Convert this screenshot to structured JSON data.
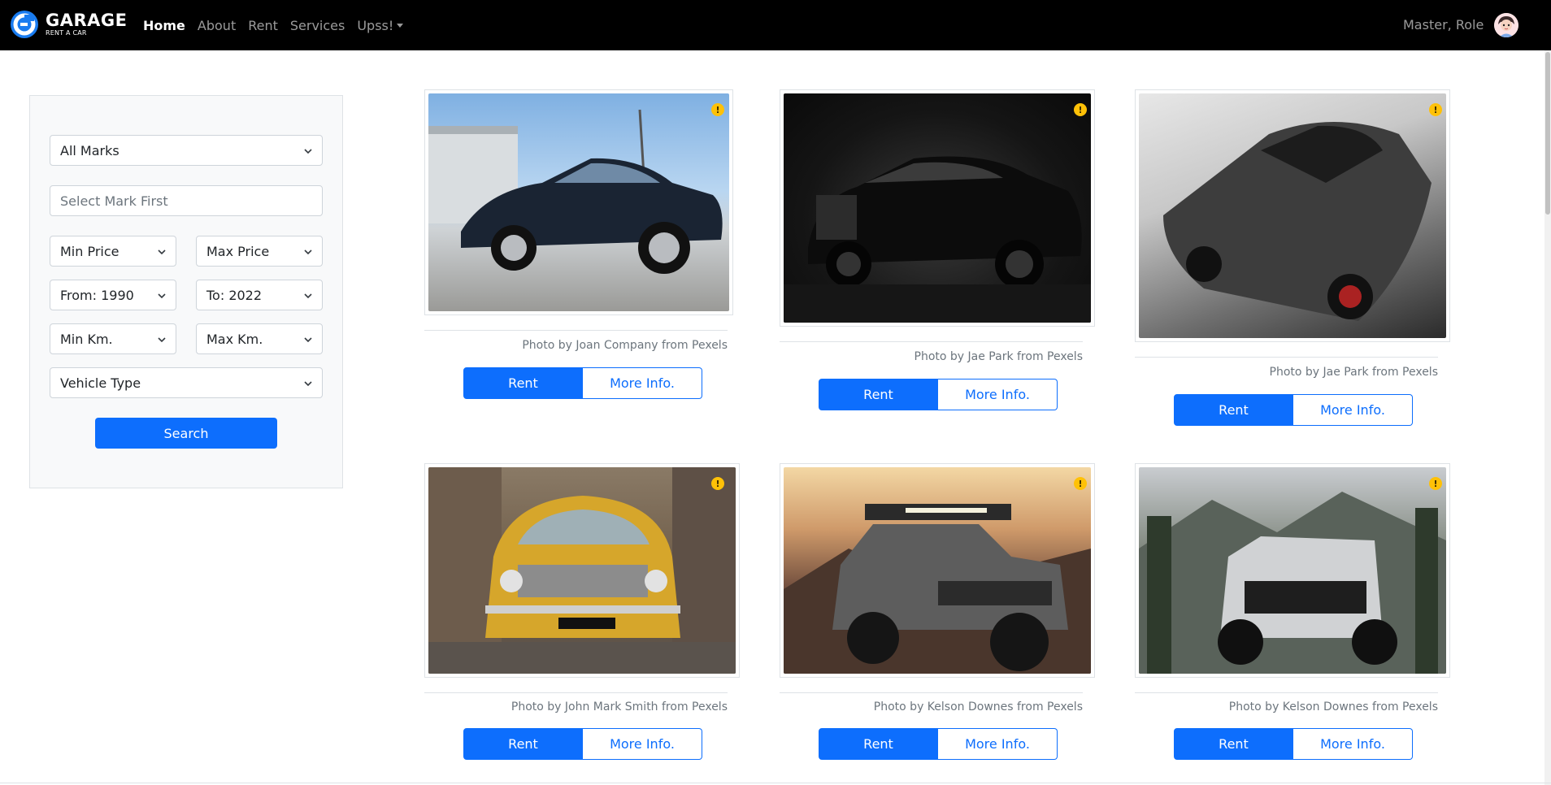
{
  "brand": {
    "name": "GARAGE",
    "subtitle": "RENT A CAR"
  },
  "nav": {
    "links": [
      "Home",
      "About",
      "Rent",
      "Services",
      "Upss!"
    ],
    "active": "Home",
    "user": "Master, Role"
  },
  "filters": {
    "marks": "All Marks",
    "model_placeholder": "Select Mark First",
    "min_price": "Min Price",
    "max_price": "Max Price",
    "year_from": "From: 1990",
    "year_to": "To: 2022",
    "min_km": "Min Km.",
    "max_km": "Max Km.",
    "vehicle_type": "Vehicle Type",
    "search_label": "Search"
  },
  "cars": [
    {
      "credit": "Photo by Joan Company from Pexels",
      "rent_label": "Rent",
      "info_label": "More Info.",
      "warning": "!"
    },
    {
      "credit": "Photo by Jae Park from Pexels",
      "rent_label": "Rent",
      "info_label": "More Info.",
      "warning": "!"
    },
    {
      "credit": "Photo by Jae Park from Pexels",
      "rent_label": "Rent",
      "info_label": "More Info.",
      "warning": "!"
    },
    {
      "credit": "Photo by John Mark Smith from Pexels",
      "rent_label": "Rent",
      "info_label": "More Info.",
      "warning": "!"
    },
    {
      "credit": "Photo by Kelson Downes from Pexels",
      "rent_label": "Rent",
      "info_label": "More Info.",
      "warning": "!"
    },
    {
      "credit": "Photo by Kelson Downes from Pexels",
      "rent_label": "Rent",
      "info_label": "More Info.",
      "warning": "!"
    }
  ],
  "colors": {
    "primary": "#0d6efd",
    "navbar": "#000000",
    "warning": "#ffc107"
  }
}
